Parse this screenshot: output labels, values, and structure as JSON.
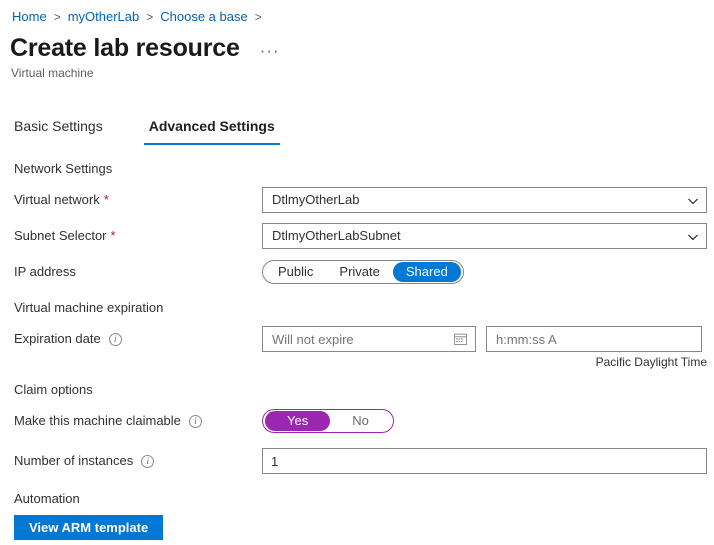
{
  "breadcrumb": {
    "items": [
      {
        "label": "Home"
      },
      {
        "label": "myOtherLab"
      },
      {
        "label": "Choose a base"
      }
    ],
    "separator": ">"
  },
  "header": {
    "title": "Create lab resource",
    "more_label": "···",
    "subtitle": "Virtual machine"
  },
  "tabs": [
    {
      "label": "Basic Settings",
      "active": false
    },
    {
      "label": "Advanced Settings",
      "active": true
    }
  ],
  "sections": {
    "network": {
      "header": "Network Settings",
      "virtual_network": {
        "label": "Virtual network",
        "required_marker": "*",
        "value": "DtlmyOtherLab"
      },
      "subnet_selector": {
        "label": "Subnet Selector",
        "required_marker": "*",
        "value": "DtlmyOtherLabSubnet"
      },
      "ip_address": {
        "label": "IP address",
        "options": [
          "Public",
          "Private",
          "Shared"
        ],
        "selected": "Shared"
      }
    },
    "expiration": {
      "header": "Virtual machine expiration",
      "expiration_date": {
        "label": "Expiration date",
        "info_glyph": "i",
        "date_placeholder": "Will not expire",
        "time_placeholder": "h:mm:ss A"
      },
      "timezone_note": "Pacific Daylight Time"
    },
    "claim": {
      "header": "Claim options",
      "claimable": {
        "label": "Make this machine claimable",
        "info_glyph": "i",
        "options": [
          "Yes",
          "No"
        ],
        "selected": "Yes"
      },
      "instances": {
        "label": "Number of instances",
        "info_glyph": "i",
        "value": "1"
      }
    },
    "automation": {
      "header": "Automation",
      "arm_button": "View ARM template"
    }
  },
  "colors": {
    "accent_blue": "#0078d4",
    "link_blue": "#0063b1",
    "claim_purple": "#9b27b0",
    "required_red": "#a4262c"
  }
}
